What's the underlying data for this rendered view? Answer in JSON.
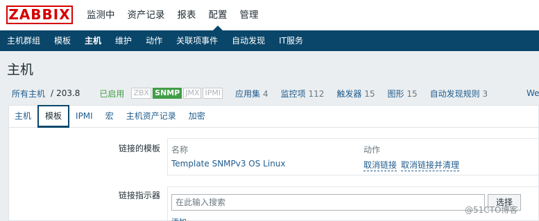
{
  "brand": "ZABBIX",
  "top_menu": [
    "监测中",
    "资产记录",
    "报表",
    "配置",
    "管理"
  ],
  "sub_menu": [
    "主机群组",
    "模板",
    "主机",
    "维护",
    "动作",
    "关联项事件",
    "自动发现",
    "IT服务"
  ],
  "page_title": "主机",
  "infobar": {
    "all_hosts": "所有主机",
    "separator": "/",
    "host": "203.8",
    "status": "已启用",
    "availability": [
      "ZBX",
      "SNMP",
      "JMX",
      "IPMI"
    ],
    "counts": [
      {
        "label": "应用集",
        "n": "4"
      },
      {
        "label": "监控项",
        "n": "112"
      },
      {
        "label": "触发器",
        "n": "15"
      },
      {
        "label": "图形",
        "n": "15"
      },
      {
        "label": "自动发现规则",
        "n": "3"
      }
    ],
    "cut_off": "We"
  },
  "tabs": [
    "主机",
    "模板",
    "IPMI",
    "宏",
    "主机资产记录",
    "加密"
  ],
  "linked_templates": {
    "label": "链接的模板",
    "col_name": "名称",
    "col_action": "动作",
    "template_name": "Template SNMPv3 OS Linux",
    "unlink": "取消链接",
    "unlink_clear": "取消链接并清理"
  },
  "link_indicator": {
    "label": "链接指示器",
    "placeholder": "在此输入搜索",
    "select": "选择",
    "add": "添加"
  },
  "watermark": "@51CTO博客",
  "colors": {
    "nav": "#0a466a",
    "link": "#1f5b8c",
    "green": "#429e47",
    "logo": "#d40000"
  }
}
